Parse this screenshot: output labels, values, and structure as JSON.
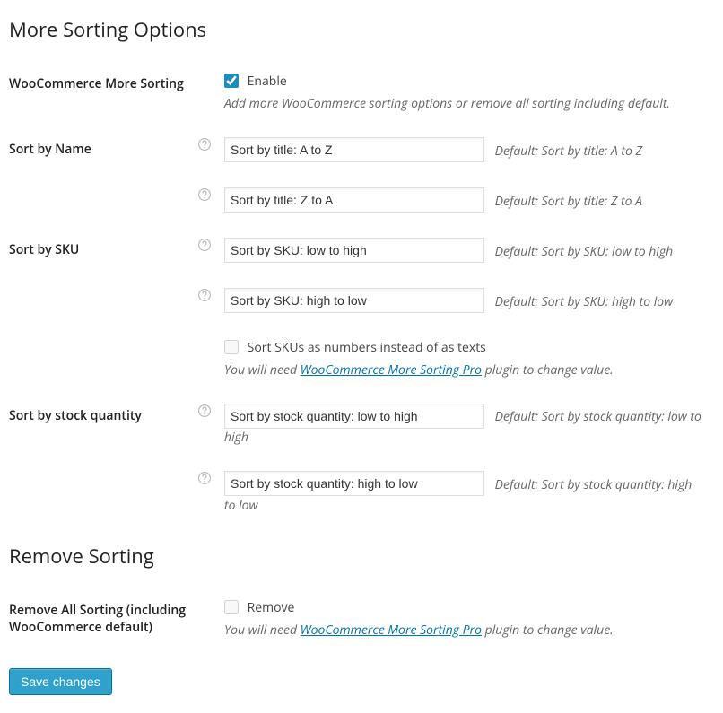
{
  "section_main_title": "More Sorting Options",
  "main": {
    "label": "WooCommerce More Sorting",
    "enable_checkbox_label": "Enable",
    "enable_checked": true,
    "desc": "Add more WooCommerce sorting options or remove all sorting including default."
  },
  "sort_name": {
    "label": "Sort by Name",
    "asc_value": "Sort by title: A to Z",
    "asc_default": "Default: Sort by title: A to Z",
    "desc_value": "Sort by title: Z to A",
    "desc_default": "Default: Sort by title: Z to A"
  },
  "sort_sku": {
    "label": "Sort by SKU",
    "low_value": "Sort by SKU: low to high",
    "low_default": "Default: Sort by SKU: low to high",
    "high_value": "Sort by SKU: high to low",
    "high_default": "Default: Sort by SKU: high to low",
    "numbers_checkbox_label": "Sort SKUs as numbers instead of as texts",
    "pro_note_prefix": "You will need ",
    "pro_link_text": "WooCommerce More Sorting Pro",
    "pro_note_suffix": " plugin to change value."
  },
  "sort_stock": {
    "label": "Sort by stock quantity",
    "low_value": "Sort by stock quantity: low to high",
    "low_default": "Default: Sort by stock quantity: low to high",
    "high_value": "Sort by stock quantity: high to low",
    "high_default": "Default: Sort by stock quantity: high to low"
  },
  "section_remove_title": "Remove Sorting",
  "remove": {
    "label": "Remove All Sorting (including WooCommerce default)",
    "checkbox_label": "Remove",
    "pro_note_prefix": "You will need ",
    "pro_link_text": "WooCommerce More Sorting Pro",
    "pro_note_suffix": " plugin to change value."
  },
  "save_button": "Save changes"
}
